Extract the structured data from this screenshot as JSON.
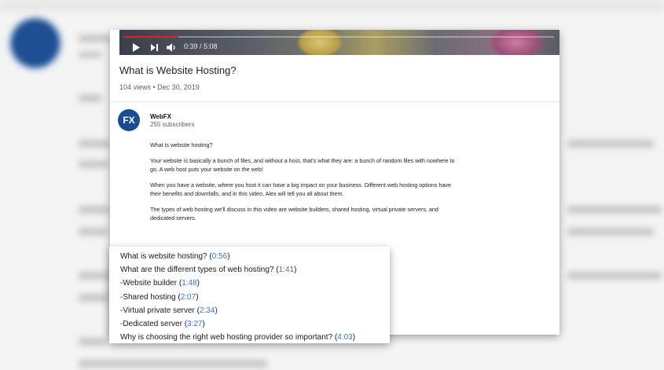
{
  "video": {
    "current_time": "0:39",
    "duration": "5:08",
    "time_display": "0:39 / 5:08",
    "progress": 0.127
  },
  "title": "What is Website Hosting?",
  "meta": "104 views • Dec 30, 2019",
  "channel": {
    "avatar_text": "FX",
    "name": "WebFX",
    "subscribers": "255 subscribers"
  },
  "description": [
    "What is website hosting?",
    "Your website is basically a bunch of files, and without a host, that's what they are: a bunch of random files with nowhere to go. A web host puts your website on the web!",
    "When you have a website, where you host it can have a big impact on your business. Different web hosting options have their benefits and downfalls, and in this video, Alex will tell you all about them.",
    "The types of web hosting we'll discuss in this video are website builders, shared hosting, virtual private servers, and dedicated servers."
  ],
  "chapters": [
    {
      "label": "What is website hosting? (",
      "time": "0:56",
      "close": ")"
    },
    {
      "label": "What are the different types of web hosting? (",
      "time": "1:41",
      "close": ")"
    },
    {
      "label": "-Website builder (",
      "time": "1:48",
      "close": ")"
    },
    {
      "label": "-Shared hosting (",
      "time": "2:07",
      "close": ")"
    },
    {
      "label": "-Virtual private server (",
      "time": "2:34",
      "close": ")"
    },
    {
      "label": "-Dedicated server (",
      "time": "3:27",
      "close": ")"
    },
    {
      "label": "Why is choosing the right web hosting provider so important? (",
      "time": "4:03",
      "close": ")"
    }
  ],
  "colors": {
    "link": "#3b74c9",
    "progress": "#e62117",
    "brand": "#1b4c91"
  },
  "icons": {
    "play": "play-icon",
    "next": "next-icon",
    "volume": "volume-icon"
  }
}
